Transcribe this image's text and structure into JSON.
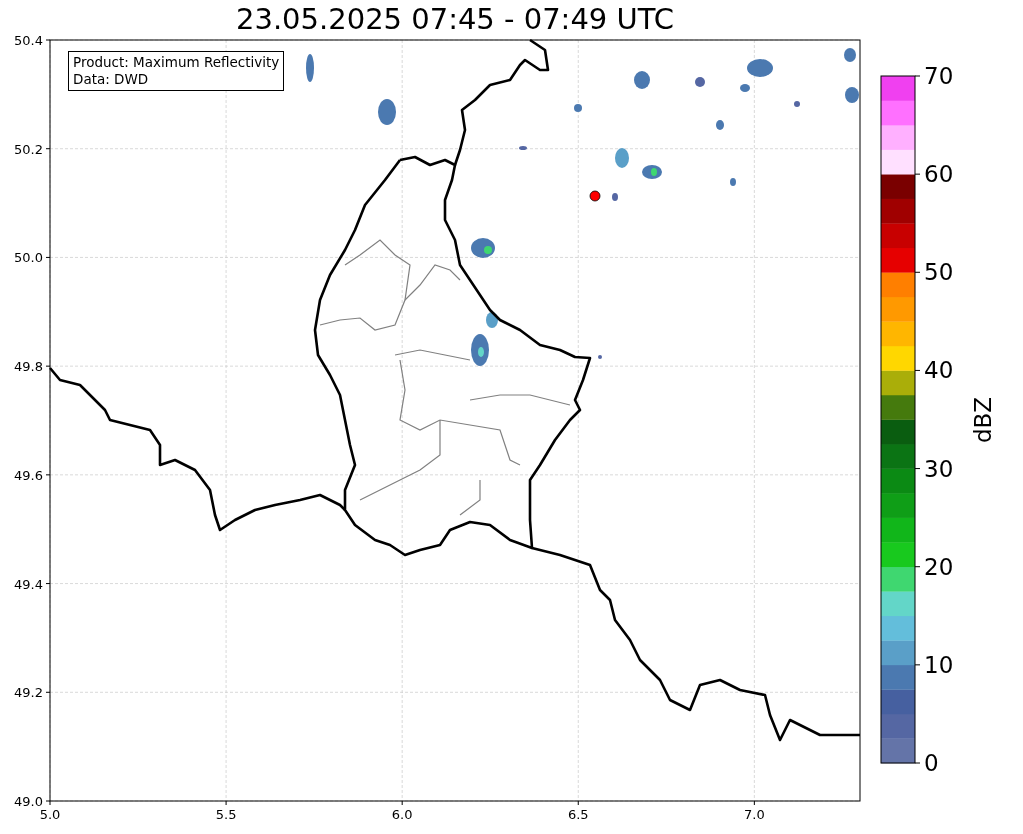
{
  "title": "23.05.2025 07:45 - 07:49 UTC",
  "map": {
    "legend": [
      "Product: Maximum Reflectivity",
      "Data: DWD"
    ],
    "x_ticks": [
      "5.0",
      "5.5",
      "6.0",
      "6.5",
      "7.0"
    ],
    "y_ticks": [
      "50.4",
      "50.2",
      "50.0",
      "49.8",
      "49.6",
      "49.4",
      "49.2",
      "49.0"
    ]
  },
  "colorbar": {
    "label": "dBZ",
    "ticks": [
      "70",
      "60",
      "50",
      "40",
      "30",
      "20",
      "10",
      "0"
    ],
    "bins": [
      {
        "color": "#6474a8"
      },
      {
        "color": "#5567a3"
      },
      {
        "color": "#4660a0"
      },
      {
        "color": "#4b79b0"
      },
      {
        "color": "#5a9fc8"
      },
      {
        "color": "#63bedb"
      },
      {
        "color": "#63d6c8"
      },
      {
        "color": "#3fd770"
      },
      {
        "color": "#18c91e"
      },
      {
        "color": "#11b61a"
      },
      {
        "color": "#0f9e17"
      },
      {
        "color": "#0b8a14"
      },
      {
        "color": "#0b7414"
      },
      {
        "color": "#0a5d10"
      },
      {
        "color": "#457a0d"
      },
      {
        "color": "#aaae09"
      },
      {
        "color": "#ffd700"
      },
      {
        "color": "#ffb600"
      },
      {
        "color": "#ff9900"
      },
      {
        "color": "#ff7f00"
      },
      {
        "color": "#e60000"
      },
      {
        "color": "#c80000"
      },
      {
        "color": "#a00000"
      },
      {
        "color": "#7a0000"
      },
      {
        "color": "#ffe0ff"
      },
      {
        "color": "#ffb0ff"
      },
      {
        "color": "#ff70ff"
      },
      {
        "color": "#f040f0"
      }
    ]
  }
}
